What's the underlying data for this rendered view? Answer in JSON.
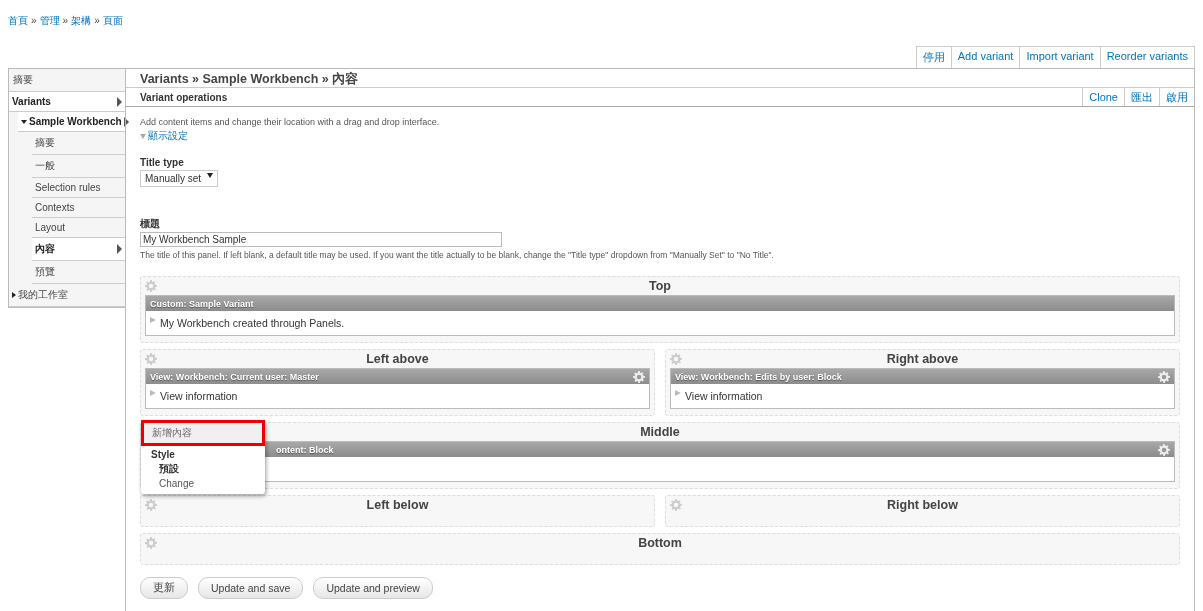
{
  "breadcrumb": {
    "separator": "»",
    "items": [
      "首頁",
      "管理",
      "架構",
      "頁面"
    ]
  },
  "top_actions": [
    "停用",
    "Add variant",
    "Import variant",
    "Reorder variants"
  ],
  "sidebar": {
    "header": "摘要",
    "items": [
      {
        "label": "Variants",
        "selected": true,
        "arrow": true,
        "children": [
          {
            "label": "Sample Workbench",
            "selected": true,
            "expanded": true,
            "arrow": true,
            "children": [
              {
                "label": "摘要",
                "selected": false,
                "arrow": false
              },
              {
                "label": "一般",
                "selected": false,
                "arrow": false
              },
              {
                "label": "Selection rules",
                "selected": false,
                "arrow": false
              },
              {
                "label": "Contexts",
                "selected": false,
                "arrow": false
              },
              {
                "label": "Layout",
                "selected": false,
                "arrow": false
              },
              {
                "label": "內容",
                "selected": true,
                "arrow": true
              },
              {
                "label": "預覽",
                "selected": false,
                "arrow": false
              }
            ]
          }
        ]
      },
      {
        "label": "我的工作室",
        "selected": false,
        "expanded": false,
        "arrow": false
      }
    ]
  },
  "main": {
    "title": "Variants » Sample Workbench » 內容",
    "subtitle": "Variant operations",
    "actions": [
      "Clone",
      "匯出",
      "啟用"
    ],
    "description": "Add content items and change their location with a drag and drop interface.",
    "display_settings": "顯示設定",
    "title_type": {
      "label": "Title type",
      "value": "Manually set"
    },
    "title_field": {
      "label": "標題",
      "value": "My Workbench Sample",
      "help": "The title of this panel. If left blank, a default title may be used. If you want the title actually to be blank, change the \"Title type\" dropdown from \"Manually Set\" to \"No Title\"."
    },
    "regions": [
      [
        {
          "name": "Top",
          "panes": [
            {
              "title": "Custom: Sample Variant",
              "content": "My Workbench created through Panels.",
              "gear": false
            }
          ]
        }
      ],
      [
        {
          "name": "Left above",
          "panes": [
            {
              "title": "View: Workbench: Current user: Master",
              "content": "View information",
              "gear": true
            }
          ]
        },
        {
          "name": "Right above",
          "panes": [
            {
              "title": "View: Workbench: Edits by user: Block",
              "content": "View information",
              "gear": true
            }
          ]
        }
      ],
      [
        {
          "name": "Middle",
          "panes": [
            {
              "title": "ontent: Block",
              "gear": true
            }
          ],
          "menu": {
            "items": [
              {
                "label": "新增內容",
                "kind": "action",
                "highlighted": true
              },
              {
                "label": "Style",
                "kind": "heading",
                "highlighted": false
              },
              {
                "label": "預設",
                "kind": "current",
                "highlighted": false
              },
              {
                "label": "Change",
                "kind": "action",
                "highlighted": false
              }
            ]
          }
        }
      ],
      [
        {
          "name": "Left below"
        },
        {
          "name": "Right below"
        }
      ],
      [
        {
          "name": "Bottom"
        }
      ]
    ],
    "buttons": [
      "更新",
      "Update and save",
      "Update and preview"
    ]
  }
}
